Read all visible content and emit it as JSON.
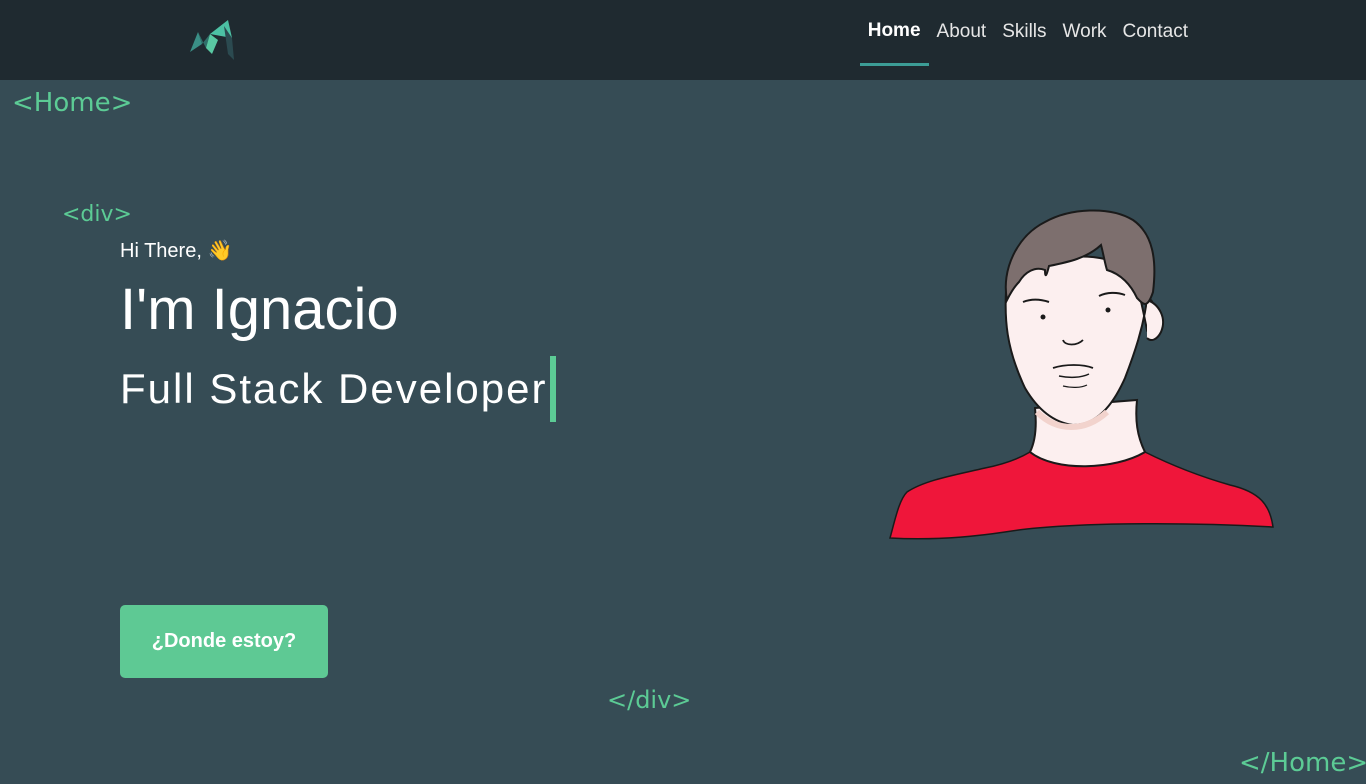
{
  "nav": {
    "items": [
      {
        "label": "Home",
        "active": true
      },
      {
        "label": "About"
      },
      {
        "label": "Skills"
      },
      {
        "label": "Work"
      },
      {
        "label": "Contact"
      }
    ]
  },
  "tags": {
    "home_open": "<Home>",
    "div_open": "<div>",
    "div_close": "</div>",
    "home_close": "</Home>"
  },
  "hero": {
    "greeting": "Hi There, 👋",
    "name": "I'm Ignacio",
    "role": "Full Stack Developer",
    "cta_label": "¿Donde estoy?"
  },
  "colors": {
    "background": "#364c55",
    "header": "#1f2a30",
    "accent": "#5ccb95",
    "active_underline": "#3c9d96",
    "shirt": "#ef163a"
  },
  "icons": {
    "logo": "logo-mark",
    "portrait": "avatar-illustration"
  }
}
